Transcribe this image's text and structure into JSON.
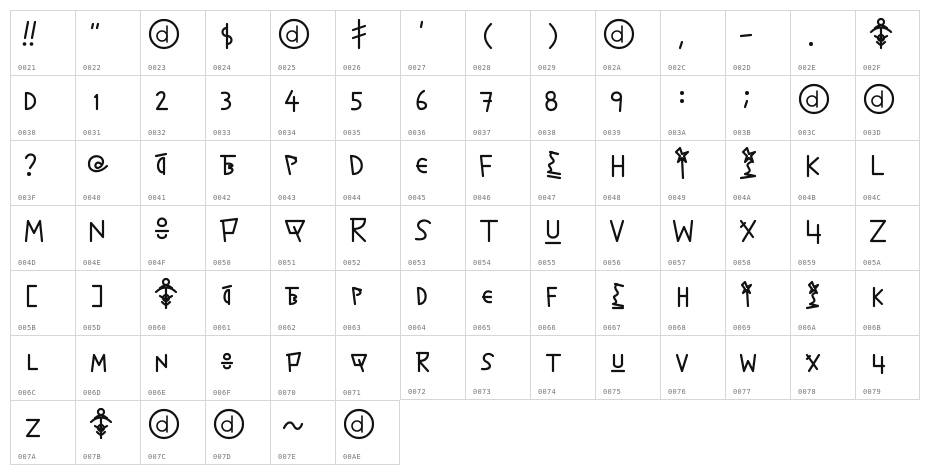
{
  "cells": [
    {
      "code": "0021",
      "icon": "exclam-icon"
    },
    {
      "code": "0022",
      "icon": "quotedbl-icon"
    },
    {
      "code": "0023",
      "icon": "circled-d-icon"
    },
    {
      "code": "0024",
      "icon": "dollar-icon"
    },
    {
      "code": "0025",
      "icon": "circled-d-icon"
    },
    {
      "code": "0026",
      "icon": "ampersand-icon"
    },
    {
      "code": "0027",
      "icon": "quotesingle-icon"
    },
    {
      "code": "0028",
      "icon": "parenleft-icon"
    },
    {
      "code": "0029",
      "icon": "parenright-icon"
    },
    {
      "code": "002A",
      "icon": "circled-d-icon"
    },
    {
      "code": "002C",
      "icon": "comma-icon"
    },
    {
      "code": "002D",
      "icon": "hyphen-icon"
    },
    {
      "code": "002E",
      "icon": "period-icon"
    },
    {
      "code": "002F",
      "icon": "ornament-icon"
    },
    {
      "code": "0030",
      "icon": "zero-icon"
    },
    {
      "code": "0031",
      "icon": "one-icon"
    },
    {
      "code": "0032",
      "icon": "two-icon"
    },
    {
      "code": "0033",
      "icon": "three-icon"
    },
    {
      "code": "0034",
      "icon": "four-icon"
    },
    {
      "code": "0035",
      "icon": "five-icon"
    },
    {
      "code": "0036",
      "icon": "six-icon"
    },
    {
      "code": "0037",
      "icon": "seven-icon"
    },
    {
      "code": "0038",
      "icon": "eight-icon"
    },
    {
      "code": "0039",
      "icon": "nine-icon"
    },
    {
      "code": "003A",
      "icon": "colon-icon"
    },
    {
      "code": "003B",
      "icon": "semicolon-icon"
    },
    {
      "code": "003C",
      "icon": "circled-d-icon"
    },
    {
      "code": "003D",
      "icon": "circled-d-icon"
    },
    {
      "code": "003F",
      "icon": "question-icon"
    },
    {
      "code": "0040",
      "icon": "at-icon"
    },
    {
      "code": "0041",
      "icon": "A-icon"
    },
    {
      "code": "0042",
      "icon": "B-icon"
    },
    {
      "code": "0043",
      "icon": "C-icon"
    },
    {
      "code": "0044",
      "icon": "D-icon"
    },
    {
      "code": "0045",
      "icon": "E-icon"
    },
    {
      "code": "0046",
      "icon": "F-icon"
    },
    {
      "code": "0047",
      "icon": "G-icon"
    },
    {
      "code": "0048",
      "icon": "H-icon"
    },
    {
      "code": "0049",
      "icon": "I-icon"
    },
    {
      "code": "004A",
      "icon": "J-icon"
    },
    {
      "code": "004B",
      "icon": "K-icon"
    },
    {
      "code": "004C",
      "icon": "L-icon"
    },
    {
      "code": "004D",
      "icon": "M-icon"
    },
    {
      "code": "004E",
      "icon": "N-icon"
    },
    {
      "code": "004F",
      "icon": "O-icon"
    },
    {
      "code": "0050",
      "icon": "P-icon"
    },
    {
      "code": "0051",
      "icon": "Q-icon"
    },
    {
      "code": "0052",
      "icon": "R-icon"
    },
    {
      "code": "0053",
      "icon": "S-icon"
    },
    {
      "code": "0054",
      "icon": "T-icon"
    },
    {
      "code": "0055",
      "icon": "U-icon"
    },
    {
      "code": "0056",
      "icon": "V-icon"
    },
    {
      "code": "0057",
      "icon": "W-icon"
    },
    {
      "code": "0058",
      "icon": "X-icon"
    },
    {
      "code": "0059",
      "icon": "Y-icon"
    },
    {
      "code": "005A",
      "icon": "Z-icon"
    },
    {
      "code": "005B",
      "icon": "bracketleft-icon"
    },
    {
      "code": "005D",
      "icon": "bracketright-icon"
    },
    {
      "code": "0060",
      "icon": "ornament-icon"
    },
    {
      "code": "0061",
      "icon": "a-icon"
    },
    {
      "code": "0062",
      "icon": "b-icon"
    },
    {
      "code": "0063",
      "icon": "c-icon"
    },
    {
      "code": "0064",
      "icon": "d-icon"
    },
    {
      "code": "0065",
      "icon": "e-icon"
    },
    {
      "code": "0066",
      "icon": "f-icon"
    },
    {
      "code": "0067",
      "icon": "g-icon"
    },
    {
      "code": "0068",
      "icon": "h-icon"
    },
    {
      "code": "0069",
      "icon": "i-icon"
    },
    {
      "code": "006A",
      "icon": "j-icon"
    },
    {
      "code": "006B",
      "icon": "k-icon"
    },
    {
      "code": "006C",
      "icon": "l-icon"
    },
    {
      "code": "006D",
      "icon": "m-icon"
    },
    {
      "code": "006E",
      "icon": "n-icon"
    },
    {
      "code": "006F",
      "icon": "o-icon"
    },
    {
      "code": "0070",
      "icon": "p-icon"
    },
    {
      "code": "0071",
      "icon": "q-icon"
    },
    {
      "code": "0072",
      "icon": "r-icon"
    },
    {
      "code": "0073",
      "icon": "s-icon"
    },
    {
      "code": "0074",
      "icon": "t-icon"
    },
    {
      "code": "0075",
      "icon": "u-icon"
    },
    {
      "code": "0076",
      "icon": "v-icon"
    },
    {
      "code": "0077",
      "icon": "w-icon"
    },
    {
      "code": "0078",
      "icon": "x-icon"
    },
    {
      "code": "0079",
      "icon": "y-icon"
    },
    {
      "code": "007A",
      "icon": "z-icon"
    },
    {
      "code": "007B",
      "icon": "ornament-icon"
    },
    {
      "code": "007C",
      "icon": "circled-d-icon"
    },
    {
      "code": "007D",
      "icon": "circled-d-icon"
    },
    {
      "code": "007E",
      "icon": "tilde-icon"
    },
    {
      "code": "00AE",
      "icon": "circled-d-icon"
    }
  ]
}
